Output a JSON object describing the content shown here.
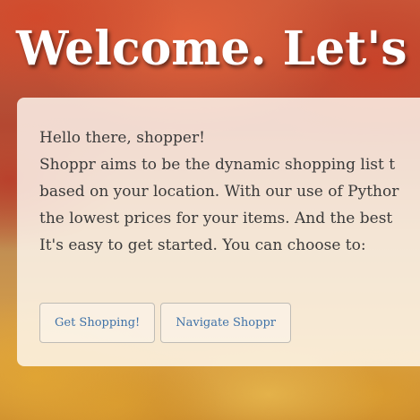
{
  "hero": {
    "title": "Welcome. Let's"
  },
  "panel": {
    "lines": [
      "Hello there, shopper!",
      "Shoppr aims to be the dynamic shopping list t",
      "based on your location. With our use of Pythor",
      "the lowest prices for your items. And the best",
      "It's easy to get started. You can choose to:"
    ],
    "buttons": {
      "get_shopping": "Get Shopping!",
      "navigate": "Navigate Shoppr"
    }
  },
  "colors": {
    "button_text": "#3f72a8",
    "panel_background": "rgba(255,250,243,0.82)",
    "title_text": "#ffffff"
  }
}
